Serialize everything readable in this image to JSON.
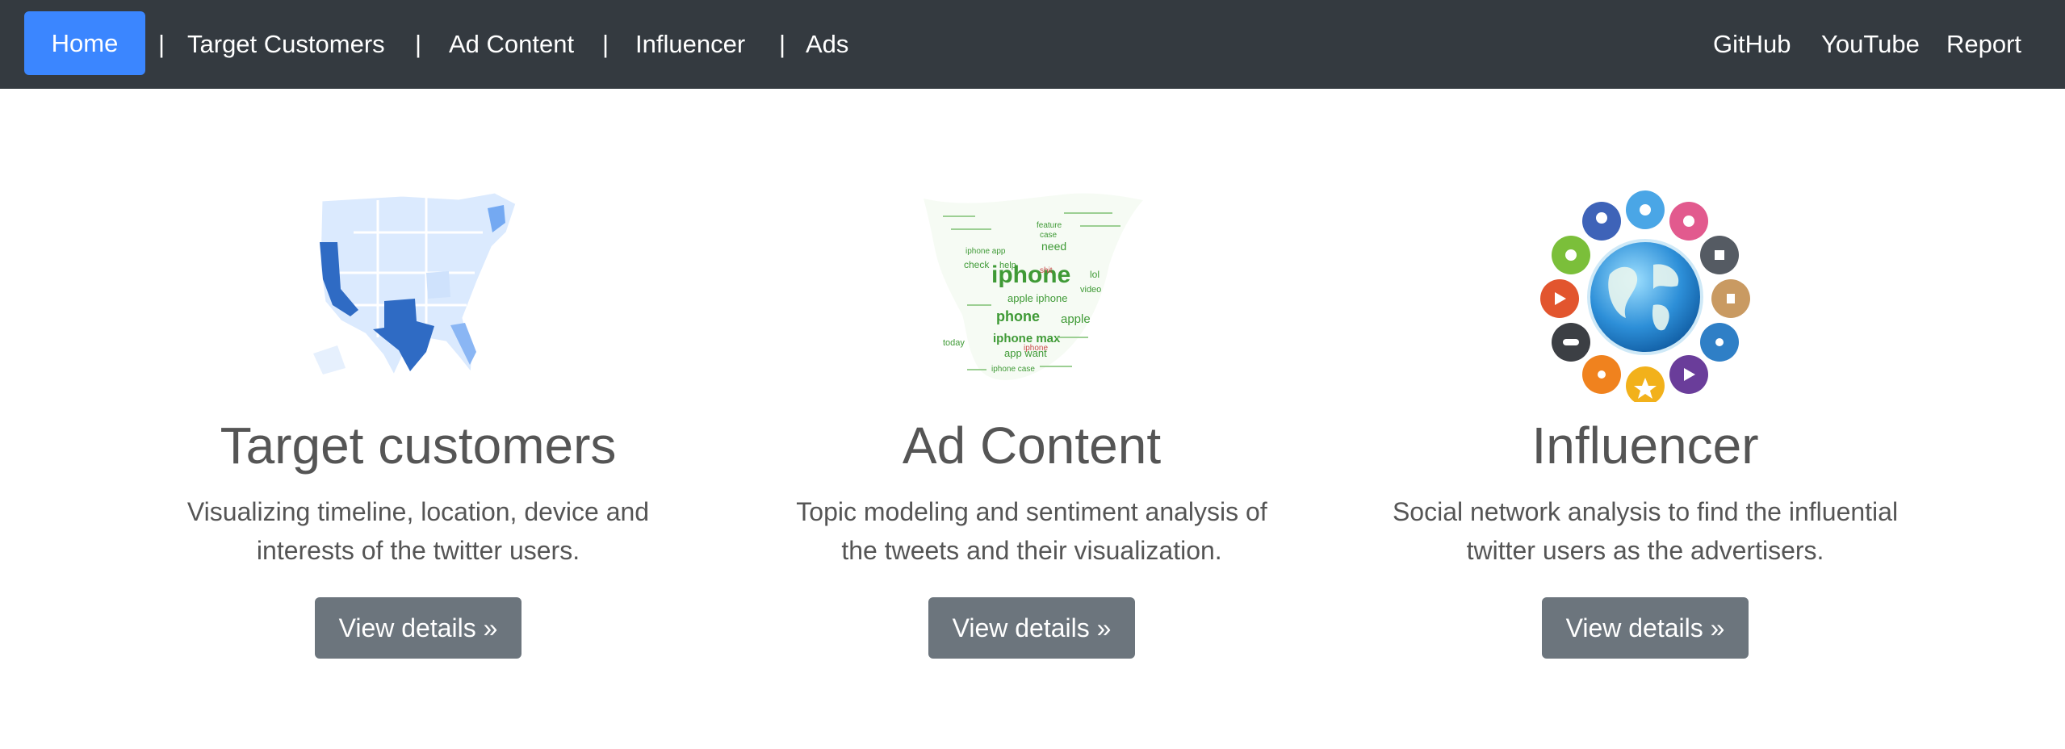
{
  "nav": {
    "home": "Home",
    "separator": "|",
    "items": [
      "Target Customers",
      "Ad Content",
      "Influencer",
      "Ads"
    ],
    "right": [
      "GitHub",
      "YouTube",
      "Report"
    ]
  },
  "cards": [
    {
      "heading": "Target customers",
      "desc_line1": "Visualizing timeline, location, device and",
      "desc_line2": "interests of the twitter users.",
      "button": "View details »",
      "image": "us-map-image"
    },
    {
      "heading": "Ad Content",
      "desc_line1": "Topic modeling and sentiment analysis of",
      "desc_line2": "the tweets and their visualization.",
      "button": "View details »",
      "image": "twitter-bird-word-cloud-image"
    },
    {
      "heading": "Influencer",
      "desc_line1": "Social network analysis to find the influential",
      "desc_line2": "twitter users as the advertisers.",
      "button": "View details »",
      "image": "social-network-globe-image"
    }
  ],
  "wordcloud": {
    "words": [
      "iphone",
      "phone",
      "apple iphone",
      "iphone max",
      "need",
      "apple",
      "app want",
      "check",
      "help",
      "iphone app",
      "iphone case",
      "case",
      "today",
      "video",
      "lol",
      "feature"
    ]
  },
  "colors": {
    "navbar": "#343a40",
    "active": "#3b86ff",
    "button": "#6c757d",
    "text": "#555555",
    "map_light": "#dbeafe",
    "map_dark": "#2f6bc4"
  }
}
